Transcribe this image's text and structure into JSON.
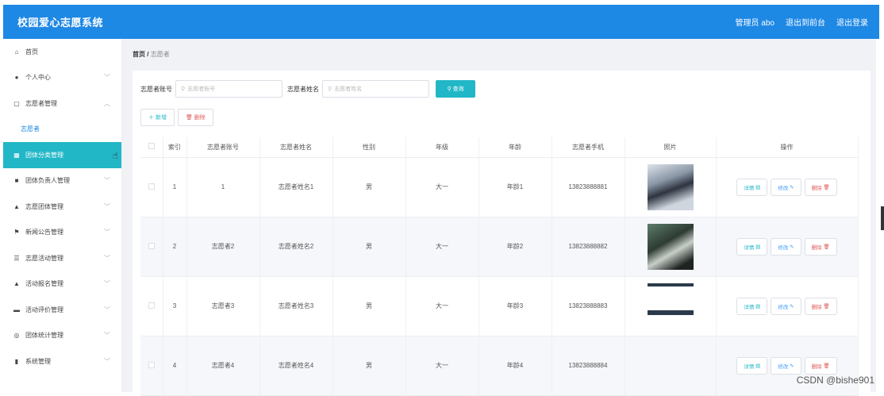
{
  "app": {
    "title": "校园爱心志愿系统",
    "user": "管理员 abo",
    "back_front": "退出到前台",
    "logout": "退出登录"
  },
  "sidebar": {
    "items": [
      {
        "label": "首页",
        "icon": "home-icon"
      },
      {
        "label": "个人中心",
        "icon": "user-icon"
      },
      {
        "label": "志愿者管理",
        "icon": "copy-icon"
      },
      {
        "label": "志愿者",
        "icon": ""
      },
      {
        "label": "团体分类管理",
        "icon": "grid-icon"
      },
      {
        "label": "团体负责人管理",
        "icon": "square-icon"
      },
      {
        "label": "志愿团体管理",
        "icon": "thumb-icon"
      },
      {
        "label": "新闻公告管理",
        "icon": "flag-icon"
      },
      {
        "label": "志愿活动管理",
        "icon": "sliders-icon"
      },
      {
        "label": "活动报名管理",
        "icon": "bank-icon"
      },
      {
        "label": "活动评价管理",
        "icon": "book-icon"
      },
      {
        "label": "团体统计管理",
        "icon": "circle-icon"
      },
      {
        "label": "系统管理",
        "icon": "bars-icon"
      }
    ]
  },
  "breadcrumb": {
    "home": "首页",
    "sep": "/",
    "current": "志愿者"
  },
  "search": {
    "account_label": "志愿者账号",
    "account_placeholder": "志愿者账号",
    "name_label": "志愿者姓名",
    "name_placeholder": "志愿者姓名",
    "query_button": "查询"
  },
  "actions": {
    "add": "新增",
    "delete": "删除"
  },
  "table": {
    "headers": [
      "",
      "索引",
      "志愿者账号",
      "志愿者姓名",
      "性别",
      "年级",
      "年龄",
      "志愿者手机",
      "照片",
      "操作"
    ],
    "rows": [
      {
        "index": "1",
        "account": "1",
        "name": "志愿者姓名1",
        "gender": "男",
        "grade": "大一",
        "age": "年龄1",
        "phone": "13823888881"
      },
      {
        "index": "2",
        "account": "志愿者2",
        "name": "志愿者姓名2",
        "gender": "男",
        "grade": "大一",
        "age": "年龄2",
        "phone": "13823888882"
      },
      {
        "index": "3",
        "account": "志愿者3",
        "name": "志愿者姓名3",
        "gender": "男",
        "grade": "大一",
        "age": "年龄3",
        "phone": "13823888883"
      },
      {
        "index": "4",
        "account": "志愿者4",
        "name": "志愿者姓名4",
        "gender": "男",
        "grade": "大一",
        "age": "年龄4",
        "phone": "13823888884"
      }
    ],
    "op_detail": "详情",
    "op_edit": "修改",
    "op_delete": "删除"
  },
  "watermark": "CSDN @bishe901",
  "colors": {
    "header": "#1e88e5",
    "accent": "#22b7c7",
    "danger": "#e15a5a"
  }
}
